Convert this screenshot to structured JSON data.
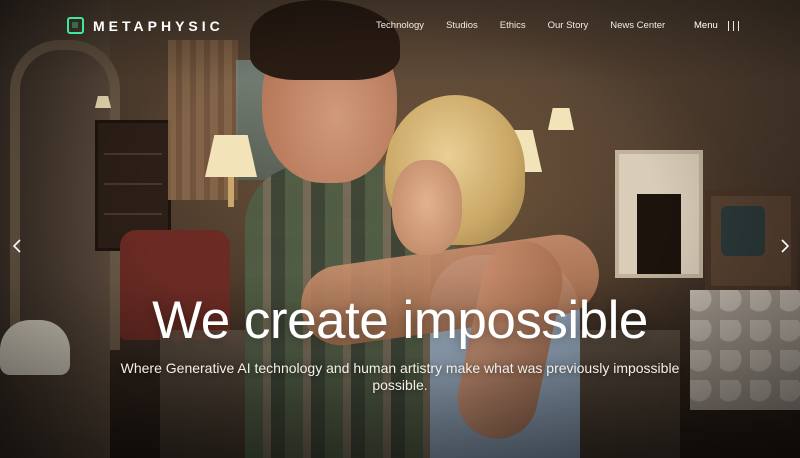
{
  "brand": {
    "name": "METAPHYSIC",
    "accent_color": "#3ee89a"
  },
  "nav": {
    "items": [
      {
        "label": "Technology"
      },
      {
        "label": "Studios"
      },
      {
        "label": "Ethics"
      },
      {
        "label": "Our Story"
      },
      {
        "label": "News Center"
      }
    ],
    "menu_label": "Menu",
    "menu_icon": "hamburger-icon"
  },
  "hero": {
    "headline": "We create impossible",
    "subheadline": "Where Generative AI technology and human artistry make what was previously impossible possible.",
    "prev_icon": "chevron-left-icon",
    "next_icon": "chevron-right-icon"
  }
}
